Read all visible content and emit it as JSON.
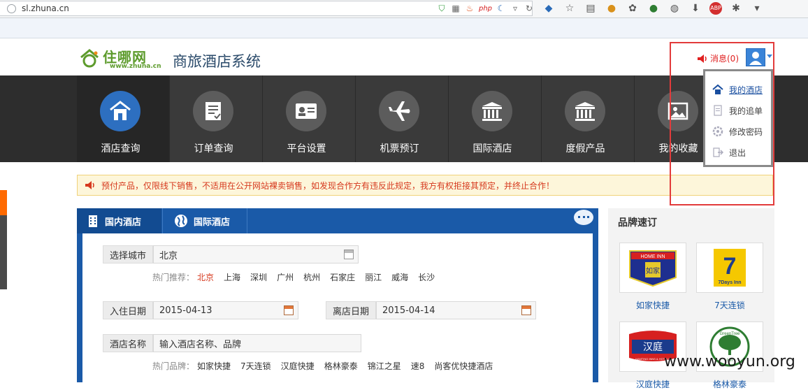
{
  "browser": {
    "url": "sl.zhuna.cn",
    "url_icons": [
      "shield-icon",
      "qr-icon",
      "fire-icon",
      "php-icon",
      "moon-icon",
      "dropdown-icon",
      "reload-icon"
    ],
    "php_label": "php",
    "abp_label": "ABP"
  },
  "header": {
    "logo_cn": "住哪网",
    "logo_url": "www.zhuna.cn",
    "site_title": "商旅酒店系统",
    "message_label": "消息(0)"
  },
  "nav": {
    "items": [
      {
        "label": "酒店查询",
        "icon": "house-icon",
        "active": true
      },
      {
        "label": "订单查询",
        "icon": "order-icon",
        "active": false
      },
      {
        "label": "平台设置",
        "icon": "id-card-icon",
        "active": false
      },
      {
        "label": "机票预订",
        "icon": "airplane-icon",
        "active": false
      },
      {
        "label": "国际酒店",
        "icon": "building-icon",
        "active": false
      },
      {
        "label": "度假产品",
        "icon": "building-icon",
        "active": false
      },
      {
        "label": "我的收藏",
        "icon": "picture-icon",
        "active": false
      }
    ]
  },
  "user_menu": {
    "items": [
      {
        "label": "我的酒店",
        "icon": "home-icon"
      },
      {
        "label": "我的追单",
        "icon": "document-icon"
      },
      {
        "label": "修改密码",
        "icon": "gear-icon"
      },
      {
        "label": "退出",
        "icon": "logout-icon"
      }
    ]
  },
  "notice": {
    "text": "预付产品，仅限线下销售，不适用在公开网站裸卖销售，如发现合作方有违反此规定，我方有权拒接其预定，并终止合作！"
  },
  "search": {
    "tabs": [
      "国内酒店",
      "国际酒店"
    ],
    "city_label": "选择城市",
    "city_value": "北京",
    "hot_city_prefix": "热门推荐：",
    "hot_cities": [
      "北京",
      "上海",
      "深圳",
      "广州",
      "杭州",
      "石家庄",
      "丽江",
      "威海",
      "长沙"
    ],
    "checkin_label": "入住日期",
    "checkin_value": "2015-04-13",
    "checkout_label": "离店日期",
    "checkout_value": "2015-04-14",
    "hotel_label": "酒店名称",
    "hotel_placeholder": "输入酒店名称、品牌",
    "hot_brand_prefix": "热门品牌：",
    "hot_brands": [
      "如家快捷",
      "7天连锁",
      "汉庭快捷",
      "格林豪泰",
      "锦江之星",
      "速8",
      "尚客优快捷酒店"
    ]
  },
  "brands": {
    "title": "品牌速订",
    "items": [
      {
        "name": "如家快捷",
        "logo_text": "如家",
        "logo_top": "HOME INN"
      },
      {
        "name": "7天连锁",
        "logo_text": "7",
        "logo_top": "7Days Inn"
      },
      {
        "name": "汉庭快捷",
        "logo_text": "汉庭",
        "logo_top": "HANTING INNS & HOTELS"
      },
      {
        "name": "格林豪泰",
        "logo_text": "GreenTree",
        "logo_top": "Inn"
      }
    ]
  },
  "watermark": "www.wooyun.org",
  "colors": {
    "nav_bg": "#2d2d2d",
    "nav_active_circle": "#2d6fc0",
    "panel_blue": "#1a5aa8",
    "notice_red": "#d6391e",
    "highlight_box": "#e23b3b"
  }
}
